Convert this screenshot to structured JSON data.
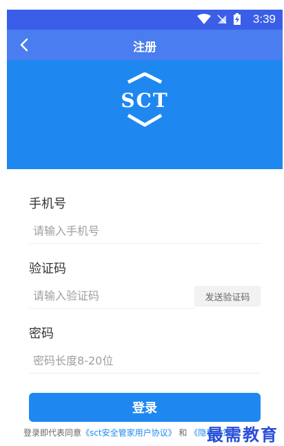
{
  "status": {
    "time": "3:39"
  },
  "appbar": {
    "title": "注册"
  },
  "banner": {
    "logo_text": "SCT"
  },
  "form": {
    "phone": {
      "label": "手机号",
      "placeholder": "请输入手机号"
    },
    "code": {
      "label": "验证码",
      "placeholder": "请输入验证码",
      "send_label": "发送验证码"
    },
    "password": {
      "label": "密码",
      "placeholder": "密码长度8-20位"
    }
  },
  "submit": {
    "label": "登录"
  },
  "agreement": {
    "prefix": "登录即代表同意",
    "link1": "《sct安全管家用户协议》",
    "conj": "和",
    "link2": "《隐私政策》"
  },
  "watermark": {
    "text": "最需教育"
  },
  "colors": {
    "primary": "#1e88f0",
    "appbar": "#4a7df0",
    "statusbar": "#3b5ee8"
  }
}
